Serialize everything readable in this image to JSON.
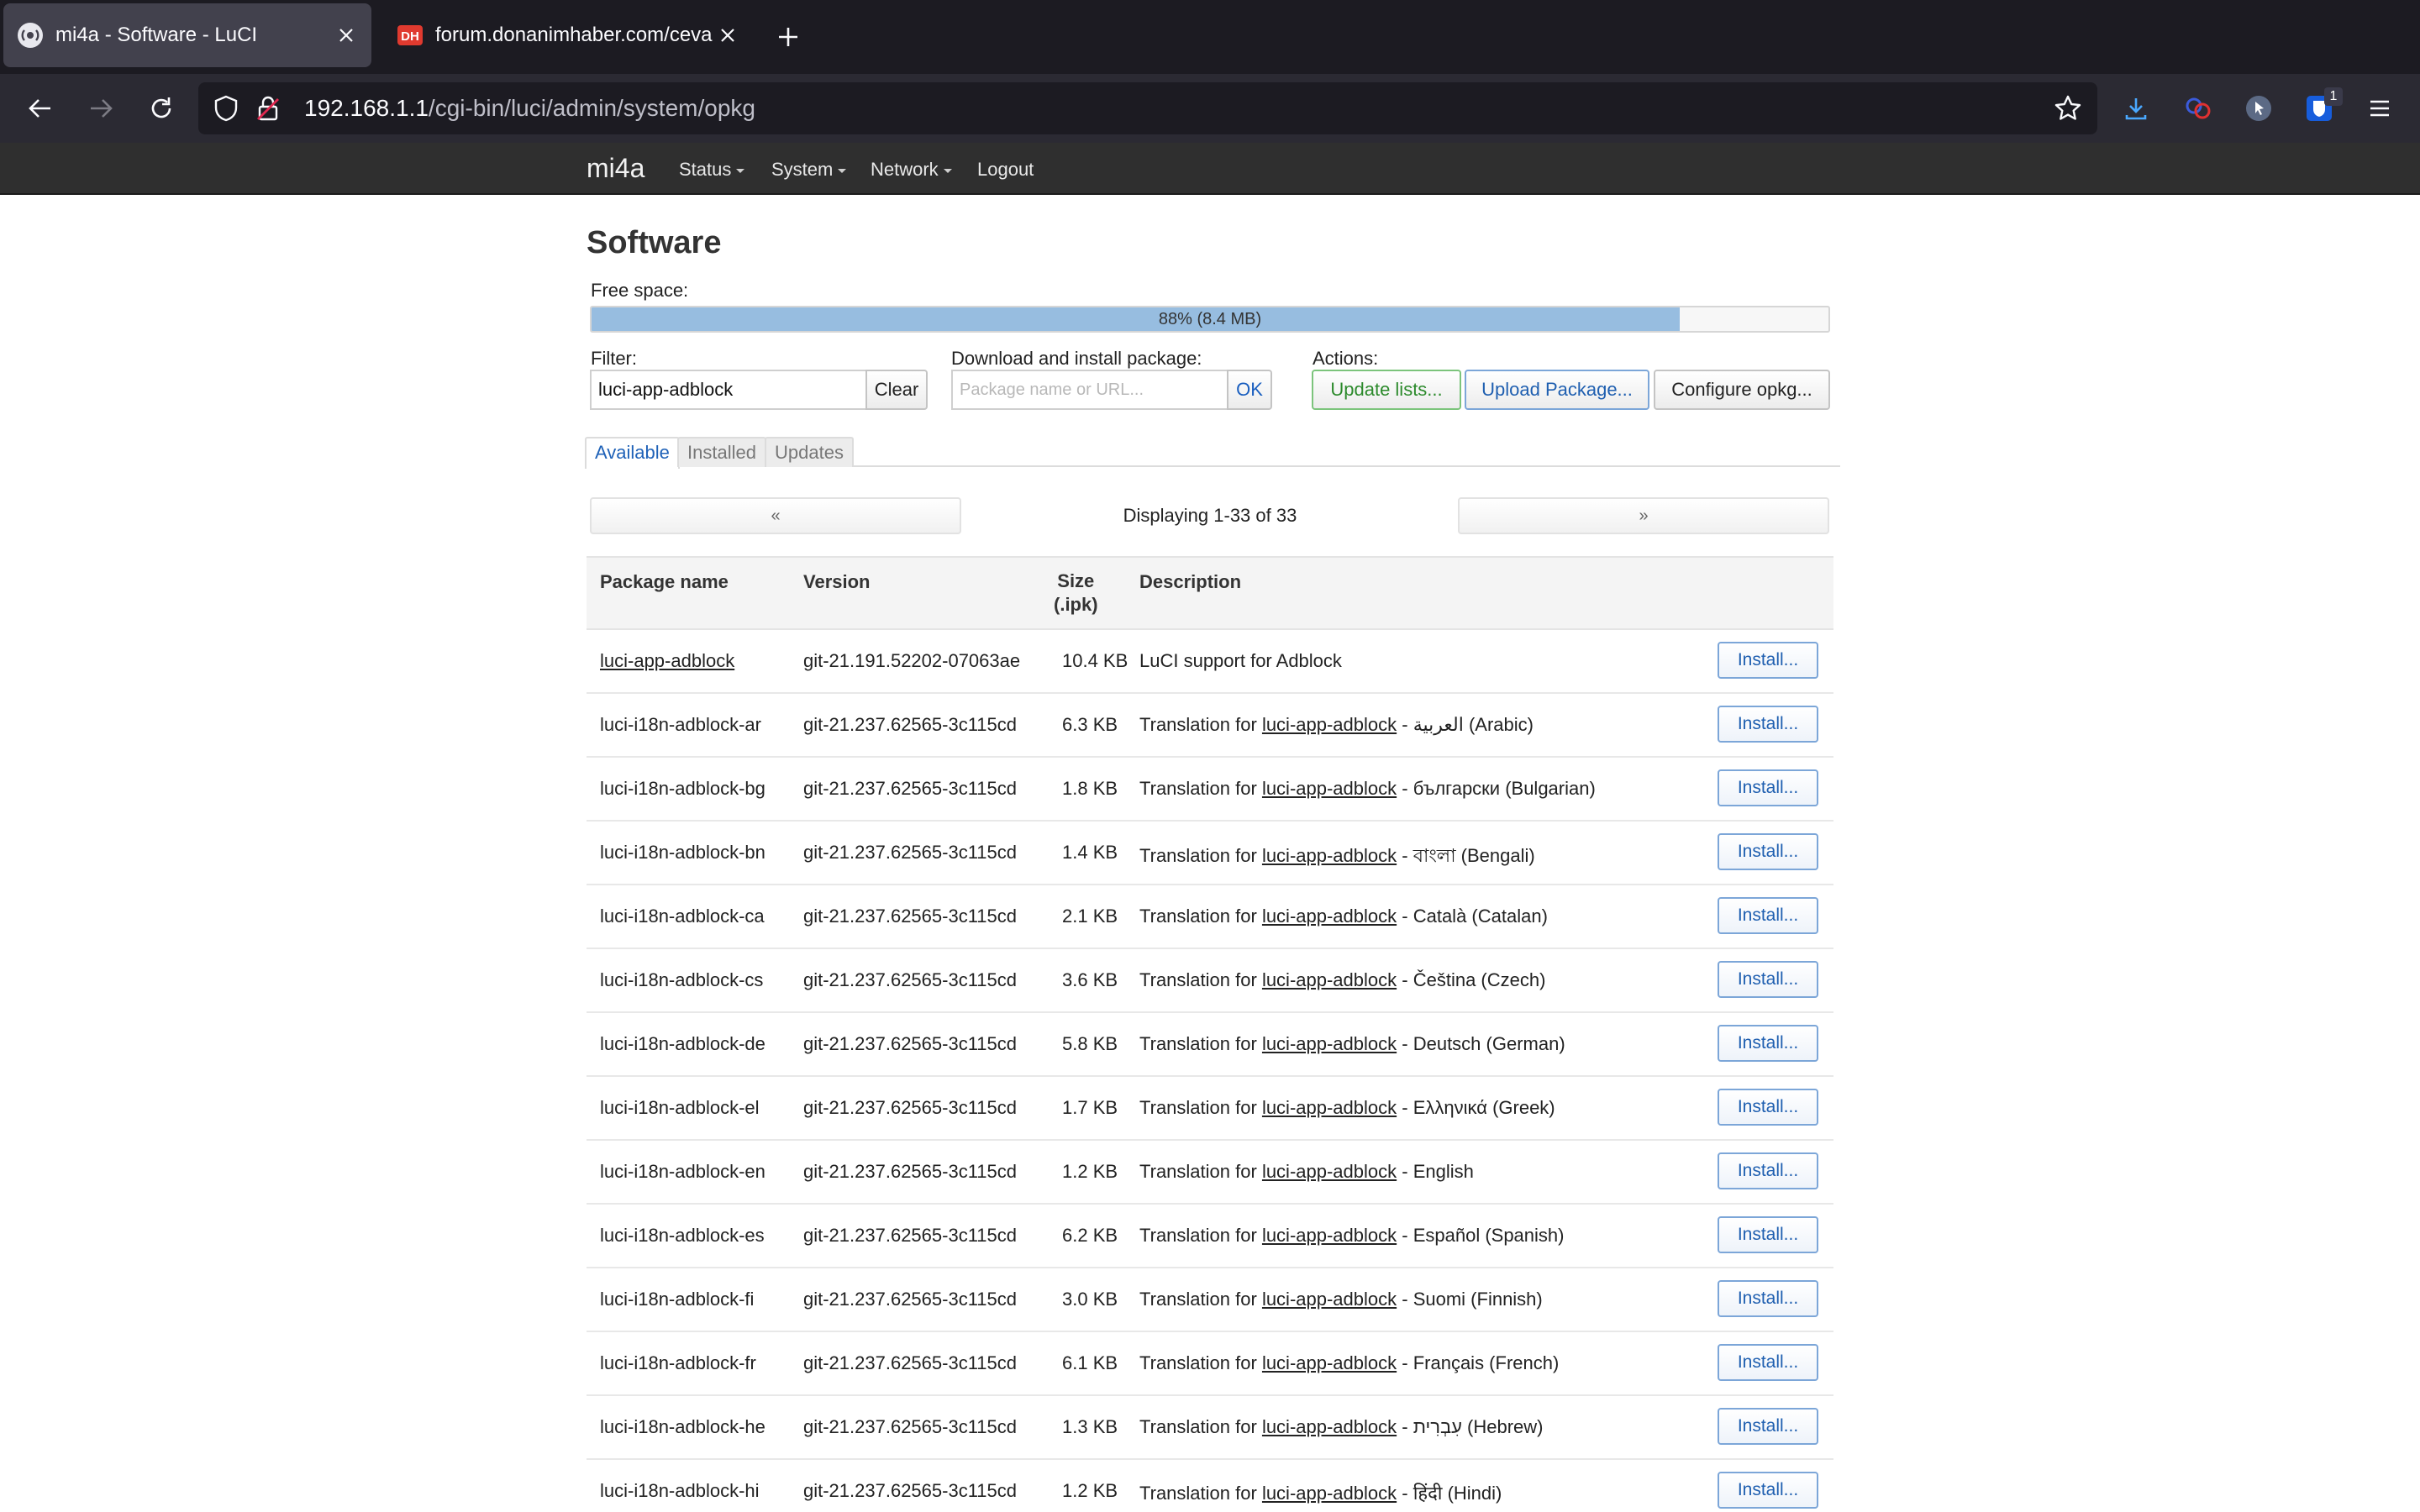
{
  "browser": {
    "tabs": [
      {
        "title": "mi4a - Software - LuCI",
        "active": true
      },
      {
        "title": "forum.donanimhaber.com/cevap",
        "favicon_text": "DH",
        "active": false
      }
    ],
    "url_host": "192.168.1.1",
    "url_path": "/cgi-bin/luci/admin/system/opkg",
    "extension_badge": "1",
    "colors": {
      "tabbar": "#1c1b22",
      "toolbar": "#2b2a33",
      "active_tab": "#42414d"
    }
  },
  "luci": {
    "brand": "mi4a",
    "menu": [
      "Status",
      "System",
      "Network",
      "Logout"
    ]
  },
  "page": {
    "title": "Software",
    "free_space_label": "Free space:",
    "free_space_text": "88% (8.4 MB)",
    "free_space_percent": 88,
    "filter_label": "Filter:",
    "filter_value": "luci-app-adblock",
    "clear_label": "Clear",
    "download_label": "Download and install package:",
    "download_placeholder": "Package name or URL...",
    "ok_label": "OK",
    "actions_label": "Actions:",
    "update_lists_label": "Update lists...",
    "upload_package_label": "Upload Package...",
    "configure_label": "Configure opkg...",
    "tabs": [
      "Available",
      "Installed",
      "Updates"
    ],
    "pager_prev": "«",
    "pager_next": "»",
    "pager_text": "Displaying 1-33 of 33"
  },
  "table": {
    "headers": {
      "name": "Package name",
      "version": "Version",
      "size_line1": "Size",
      "size_line2": "(.ipk)",
      "description": "Description"
    },
    "install_label": "Install...",
    "desc_prefix": "Translation for",
    "desc_link": "luci-app-adblock",
    "rows": [
      {
        "name": "luci-app-adblock",
        "version": "git-21.191.52202-07063ae",
        "size": "10.4 KB",
        "desc": "LuCI support for Adblock"
      },
      {
        "name": "luci-i18n-adblock-ar",
        "version": "git-21.237.62565-3c115cd",
        "size": "6.3 KB",
        "desc_suffix": "- العربية (Arabic)"
      },
      {
        "name": "luci-i18n-adblock-bg",
        "version": "git-21.237.62565-3c115cd",
        "size": "1.8 KB",
        "desc_suffix": "- български (Bulgarian)"
      },
      {
        "name": "luci-i18n-adblock-bn",
        "version": "git-21.237.62565-3c115cd",
        "size": "1.4 KB",
        "desc_suffix": "- বাংলা (Bengali)"
      },
      {
        "name": "luci-i18n-adblock-ca",
        "version": "git-21.237.62565-3c115cd",
        "size": "2.1 KB",
        "desc_suffix": "- Català (Catalan)"
      },
      {
        "name": "luci-i18n-adblock-cs",
        "version": "git-21.237.62565-3c115cd",
        "size": "3.6 KB",
        "desc_suffix": "- Čeština (Czech)"
      },
      {
        "name": "luci-i18n-adblock-de",
        "version": "git-21.237.62565-3c115cd",
        "size": "5.8 KB",
        "desc_suffix": "- Deutsch (German)"
      },
      {
        "name": "luci-i18n-adblock-el",
        "version": "git-21.237.62565-3c115cd",
        "size": "1.7 KB",
        "desc_suffix": "- Ελληνικά (Greek)"
      },
      {
        "name": "luci-i18n-adblock-en",
        "version": "git-21.237.62565-3c115cd",
        "size": "1.2 KB",
        "desc_suffix": "- English"
      },
      {
        "name": "luci-i18n-adblock-es",
        "version": "git-21.237.62565-3c115cd",
        "size": "6.2 KB",
        "desc_suffix": "- Español (Spanish)"
      },
      {
        "name": "luci-i18n-adblock-fi",
        "version": "git-21.237.62565-3c115cd",
        "size": "3.0 KB",
        "desc_suffix": "- Suomi (Finnish)"
      },
      {
        "name": "luci-i18n-adblock-fr",
        "version": "git-21.237.62565-3c115cd",
        "size": "6.1 KB",
        "desc_suffix": "- Français (French)"
      },
      {
        "name": "luci-i18n-adblock-he",
        "version": "git-21.237.62565-3c115cd",
        "size": "1.3 KB",
        "desc_suffix": "- עִבְרִית (Hebrew)"
      },
      {
        "name": "luci-i18n-adblock-hi",
        "version": "git-21.237.62565-3c115cd",
        "size": "1.2 KB",
        "desc_suffix": "- हिंदी (Hindi)"
      }
    ]
  }
}
